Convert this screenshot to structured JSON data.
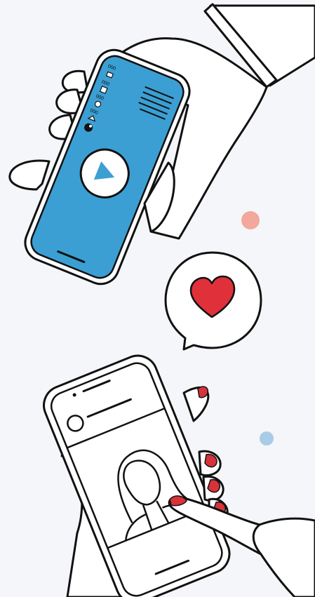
{
  "illustration": {
    "background": "#f4f6f9",
    "outline_color": "#111111",
    "phone_screen_color": "#3b9fd4",
    "heart_color": "#e0303a",
    "nail_color": "#d8323a",
    "dot_colors": [
      "#f2a89c",
      "#a9cbe6"
    ],
    "icons": [
      "play-icon",
      "heart-icon",
      "chat-bubble-icon"
    ]
  },
  "top_phone": {
    "menu_labels": [
      "000",
      "000",
      "000",
      "000"
    ]
  }
}
